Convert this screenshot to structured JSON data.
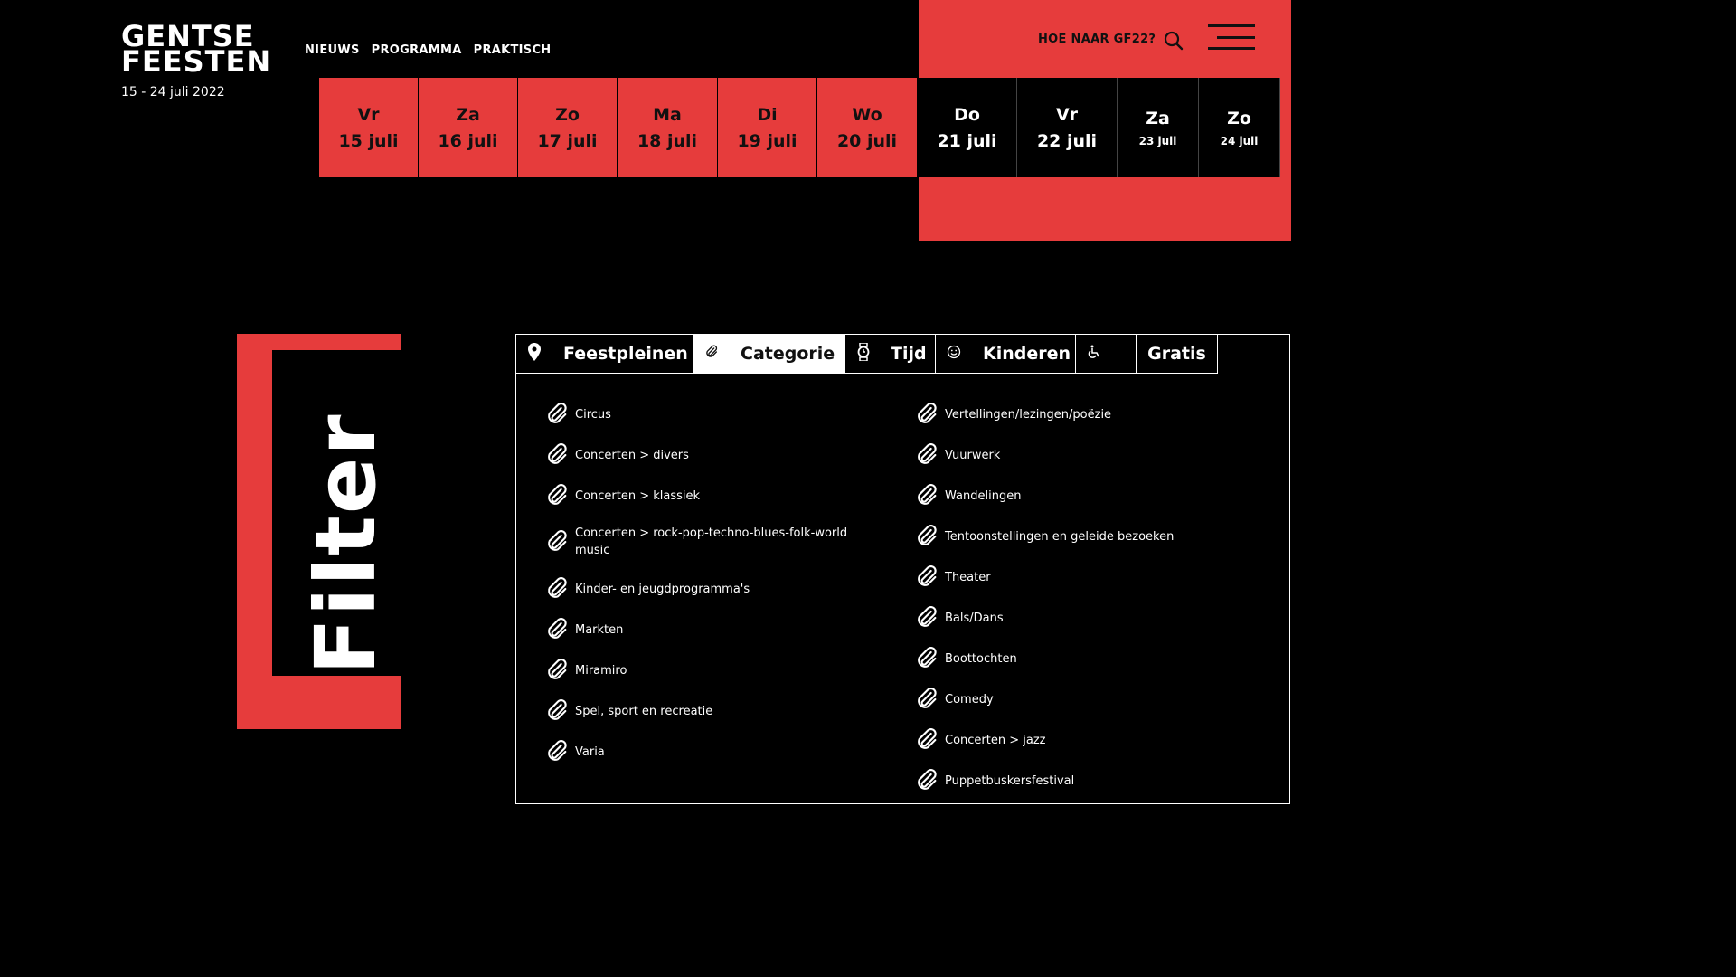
{
  "logo": {
    "line1": "GENTSE",
    "line2": "FEESTEN",
    "dates": "15 - 24 juli 2022"
  },
  "nav": {
    "items": [
      "NIEUWS",
      "PROGRAMMA",
      "PRAKTISCH"
    ]
  },
  "header": {
    "hoe_naar": "HOE NAAR GF22?",
    "search_icon": "search-icon",
    "menu_icon": "hamburger-menu-icon"
  },
  "days": [
    {
      "day": "Vr",
      "date": "15 juli"
    },
    {
      "day": "Za",
      "date": "16 juli"
    },
    {
      "day": "Zo",
      "date": "17 juli"
    },
    {
      "day": "Ma",
      "date": "18 juli"
    },
    {
      "day": "Di",
      "date": "19 juli"
    },
    {
      "day": "Wo",
      "date": "20 juli"
    },
    {
      "day": "Do",
      "date": "21 juli"
    },
    {
      "day": "Vr",
      "date": "22 juli"
    },
    {
      "day": "Za",
      "date": "23 juli"
    },
    {
      "day": "Zo",
      "date": "24 juli"
    }
  ],
  "filter": {
    "title": "Filter"
  },
  "tabs": [
    {
      "label": "Feestpleinen",
      "icon": "map-pin-icon"
    },
    {
      "label": "Categorie",
      "icon": "paperclip-icon",
      "active": true
    },
    {
      "label": "Tijd",
      "icon": "watch-icon"
    },
    {
      "label": "Kinderen",
      "icon": "smiley-icon"
    },
    {
      "label": "",
      "icon": "wheelchair-icon"
    },
    {
      "label": "Gratis",
      "icon": ""
    }
  ],
  "categories": {
    "left": [
      "Circus",
      "Concerten > divers",
      "Concerten > klassiek",
      "Concerten > rock-pop-techno-blues-folk-world music",
      "Kinder- en jeugdprogramma's",
      "Markten",
      "Miramiro",
      "Spel, sport en recreatie",
      "Varia"
    ],
    "right": [
      "Vertellingen/lezingen/poëzie",
      "Vuurwerk",
      "Wandelingen",
      "Tentoonstellingen en geleide bezoeken",
      "Theater",
      "Bals/Dans",
      "Boottochten",
      "Comedy",
      "Concerten > jazz",
      "Puppetbuskersfestival"
    ]
  }
}
